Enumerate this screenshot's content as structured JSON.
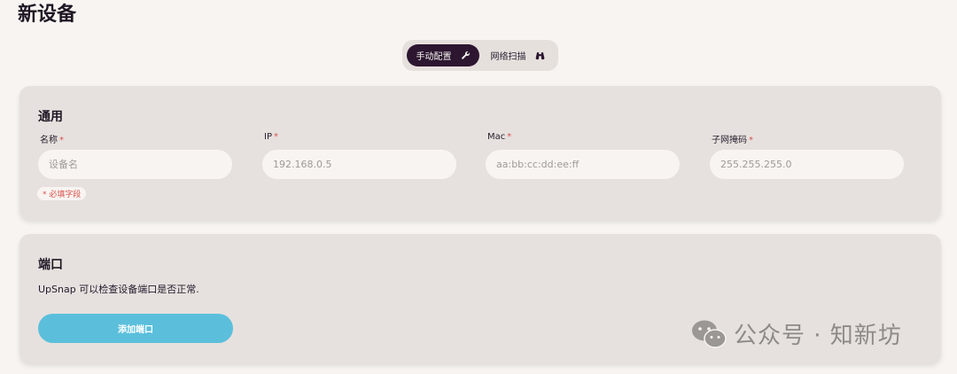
{
  "page": {
    "title": "新设备"
  },
  "mode_toggle": {
    "manual_label": "手动配置",
    "scan_label": "网络扫描"
  },
  "general": {
    "title": "通用",
    "fields": [
      {
        "label": "名称",
        "placeholder": "设备名",
        "required": "*"
      },
      {
        "label": "IP",
        "placeholder": "192.168.0.5",
        "required": "*"
      },
      {
        "label": "Mac",
        "placeholder": "aa:bb:cc:dd:ee:ff",
        "required": "*"
      },
      {
        "label": "子网掩码",
        "placeholder": "255.255.255.0",
        "required": "*"
      }
    ],
    "required_note": "* 必填字段"
  },
  "ports": {
    "title": "端口",
    "description": "UpSnap 可以检查设备端口是否正常.",
    "add_button": "添加端口"
  },
  "watermark": {
    "text": "公众号 · 知新坊"
  },
  "colors": {
    "background": "#f8f4f1",
    "card": "#e6e1de",
    "active_toggle": "#2c1630",
    "accent_button": "#5bbfdc",
    "required": "#d9534f"
  }
}
